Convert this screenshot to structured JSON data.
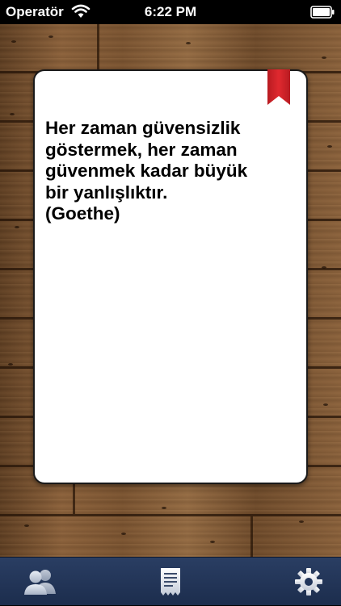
{
  "status_bar": {
    "carrier": "Operatör",
    "time": "6:22 PM",
    "wifi_icon": "wifi-icon",
    "battery_icon": "battery-icon"
  },
  "quote_card": {
    "lines": [
      "Her zaman güvensizlik",
      "göstermek, her zaman",
      "güvenmek kadar büyük",
      "bir yanlışlıktır.",
      "(Goethe)"
    ],
    "bookmark_icon": "bookmark-icon",
    "bookmark_color": "#d8242b"
  },
  "tab_bar": {
    "background_color": "#1f3052",
    "items": [
      {
        "icon": "people-icon"
      },
      {
        "icon": "document-icon"
      },
      {
        "icon": "gear-icon"
      }
    ]
  }
}
